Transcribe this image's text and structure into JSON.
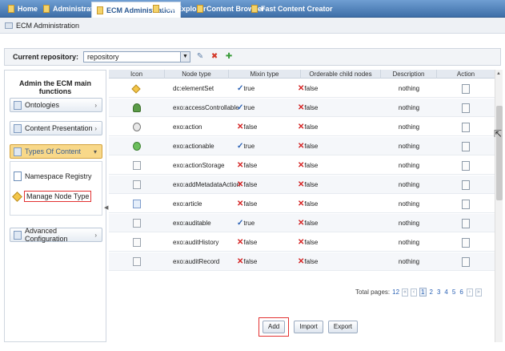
{
  "nav": {
    "tabs": [
      {
        "label": "Home"
      },
      {
        "label": "Administration"
      },
      {
        "label": "ECM Administration"
      },
      {
        "label": "File Explorer"
      },
      {
        "label": "Content Browser"
      },
      {
        "label": "Fast Content Creator"
      }
    ]
  },
  "breadcrumb": {
    "label": "ECM Administration"
  },
  "repo": {
    "label": "Current repository:",
    "value": "repository"
  },
  "left": {
    "title": "Admin the ECM main functions",
    "items": [
      {
        "label": "Ontologies"
      },
      {
        "label": "Content Presentation"
      },
      {
        "label": "Types Of Content"
      },
      {
        "label": "Advanced Configuration"
      }
    ],
    "sub": [
      {
        "label": "Namespace Registry"
      },
      {
        "label": "Manage Node Type"
      }
    ]
  },
  "table": {
    "headers": [
      "Icon",
      "Node type",
      "Mixin type",
      "Orderable child nodes",
      "Description",
      "Action"
    ],
    "rows": [
      {
        "name": "dc:elementSet",
        "mixin": "true",
        "orderable": "false",
        "desc": "nothing",
        "icon": "diamond-icon"
      },
      {
        "name": "exo:accessControllable",
        "mixin": "true",
        "orderable": "false",
        "desc": "nothing",
        "icon": "tree-icon"
      },
      {
        "name": "exo:action",
        "mixin": "false",
        "orderable": "false",
        "desc": "nothing",
        "icon": "gear-doc-icon"
      },
      {
        "name": "exo:actionable",
        "mixin": "true",
        "orderable": "false",
        "desc": "nothing",
        "icon": "green-gear-icon"
      },
      {
        "name": "exo:actionStorage",
        "mixin": "false",
        "orderable": "false",
        "desc": "nothing",
        "icon": "document-icon"
      },
      {
        "name": "exo:addMetadataAction",
        "mixin": "false",
        "orderable": "false",
        "desc": "nothing",
        "icon": "document-icon"
      },
      {
        "name": "exo:article",
        "mixin": "false",
        "orderable": "false",
        "desc": "nothing",
        "icon": "article-icon"
      },
      {
        "name": "exo:auditable",
        "mixin": "true",
        "orderable": "false",
        "desc": "nothing",
        "icon": "document-icon"
      },
      {
        "name": "exo:auditHistory",
        "mixin": "false",
        "orderable": "false",
        "desc": "nothing",
        "icon": "document-icon"
      },
      {
        "name": "exo:auditRecord",
        "mixin": "false",
        "orderable": "false",
        "desc": "nothing",
        "icon": "document-icon"
      }
    ]
  },
  "pager": {
    "label": "Total pages:",
    "total": "12",
    "pages": [
      "1",
      "2",
      "3",
      "4",
      "5",
      "6"
    ]
  },
  "buttons": {
    "add": "Add",
    "import": "Import",
    "export": "Export"
  }
}
